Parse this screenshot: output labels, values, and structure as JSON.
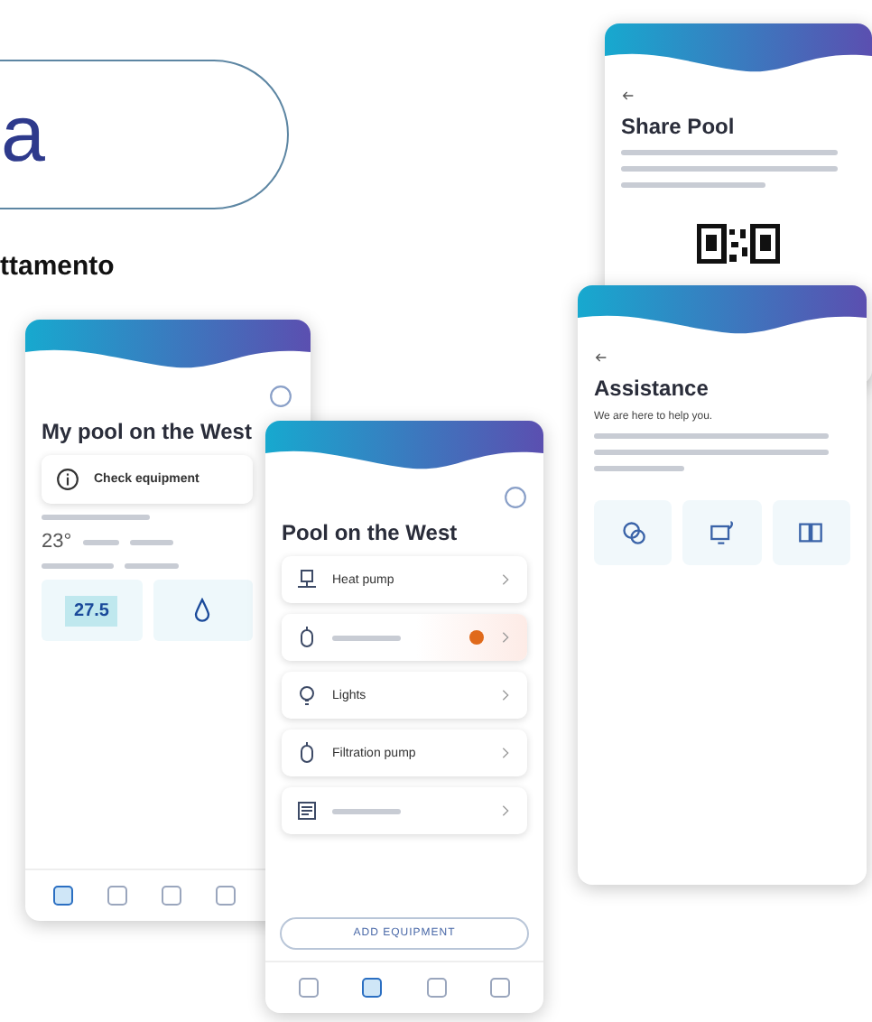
{
  "heading": {
    "text": "a"
  },
  "subheading": "ttamento",
  "home_screen": {
    "title": "My pool on the West",
    "alert": "Check equipment",
    "air_temperature": "23°",
    "water_temperature": "27.5",
    "nav": [
      {
        "selected": true
      },
      {
        "selected": false
      },
      {
        "selected": false
      },
      {
        "selected": false
      }
    ]
  },
  "equipment_screen": {
    "title": "Pool on the West",
    "button": "ADD EQUIPMENT",
    "items": [
      {
        "kind": "pump",
        "label": "Heat pump",
        "alert": false
      },
      {
        "kind": "cell",
        "alert": true,
        "color": "#e06a1b"
      },
      {
        "kind": "bulb",
        "label": "Lights",
        "alert": false
      },
      {
        "kind": "cell",
        "label": "Filtration pump",
        "alert": false
      },
      {
        "kind": "panel",
        "alert": false
      }
    ],
    "nav": [
      {
        "selected": false
      },
      {
        "selected": true
      },
      {
        "selected": false
      },
      {
        "selected": false
      }
    ]
  },
  "share_screen": {
    "title": "Share Pool"
  },
  "assistance_screen": {
    "title": "Assistance",
    "intro": "We are here to help you.",
    "channels": [
      {
        "kind": "chat"
      },
      {
        "kind": "device"
      },
      {
        "kind": "book"
      }
    ]
  }
}
